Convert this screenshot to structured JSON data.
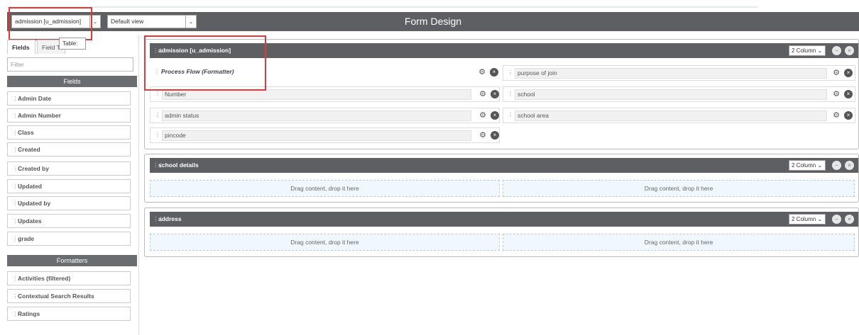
{
  "header": {
    "title": "Form Design",
    "table_select": "admission [u_admission]",
    "view_select": "Default view",
    "tooltip": "Table:"
  },
  "sidebar": {
    "tabs": [
      "Fields",
      "Field T"
    ],
    "filter_placeholder": "Filter",
    "fields_heading": "Fields",
    "fields": [
      "Admin Date",
      "Admin Number",
      "Class",
      "Created",
      "Created by",
      "Updated",
      "Updated by",
      "Updates",
      "grade"
    ],
    "formatters_heading": "Formatters",
    "formatters": [
      "Activities (filtered)",
      "Contextual Search Results",
      "Ratings"
    ]
  },
  "sections": [
    {
      "title": "admission [u_admission]",
      "columns": "2 Column",
      "left_fields": [
        "Process Flow (Formatter)",
        "Number",
        "admin status",
        "pincode"
      ],
      "right_fields": [
        "purpose of join",
        "school",
        "school area"
      ]
    },
    {
      "title": "school details",
      "columns": "2 Column",
      "drop_text": "Drag content, drop it here"
    },
    {
      "title": "address",
      "columns": "2 Column",
      "drop_text": "Drag content, drop it here"
    }
  ],
  "colors": {
    "header_bg": "#5e5f63",
    "highlight": "#e03b3b",
    "drop_bg": "#f1f8fd"
  }
}
